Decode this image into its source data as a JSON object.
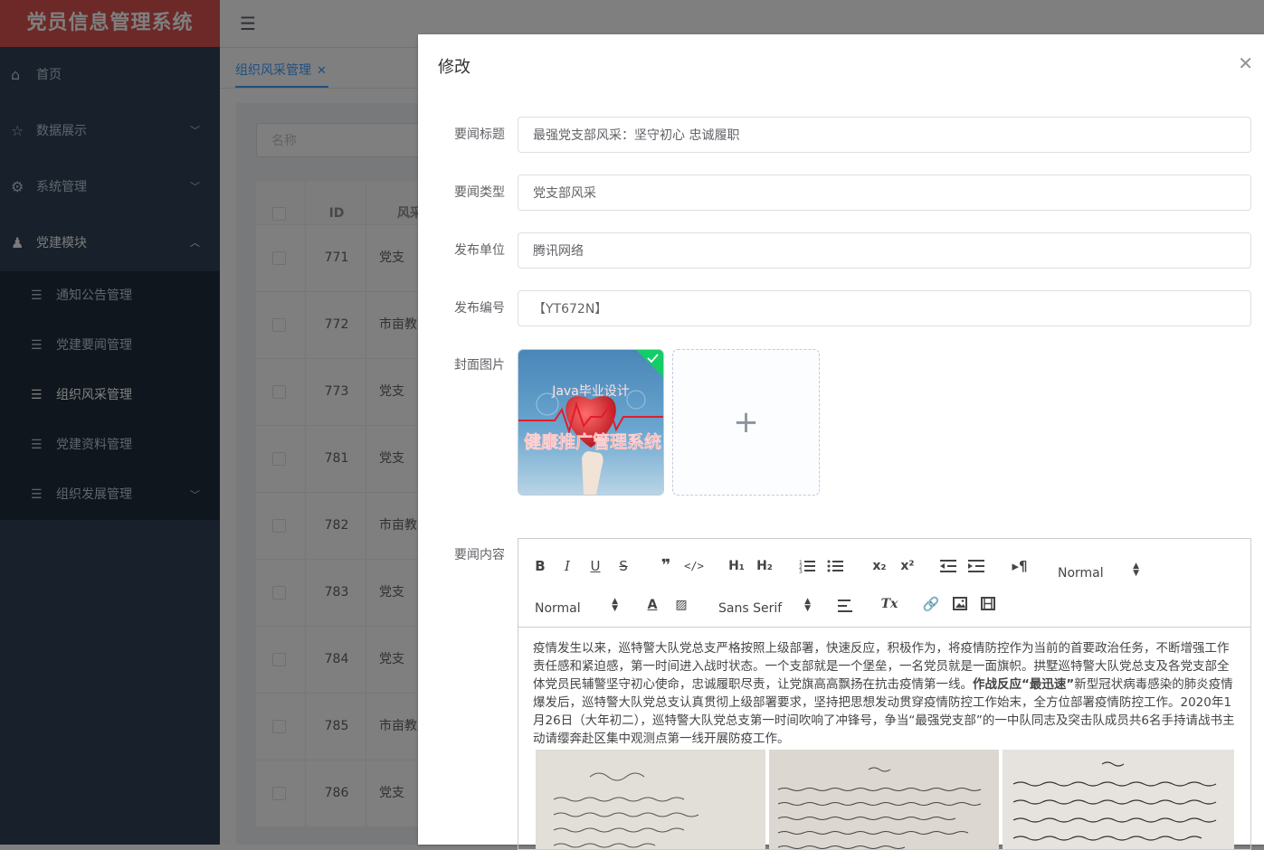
{
  "app": {
    "title": "党员信息管理系统"
  },
  "sidebar": {
    "items": [
      {
        "label": "首页",
        "icon": "home-icon"
      },
      {
        "label": "数据展示",
        "icon": "star-icon"
      },
      {
        "label": "系统管理",
        "icon": "gear-icon"
      },
      {
        "label": "党建模块",
        "icon": "user-group-icon"
      }
    ],
    "subitems": [
      {
        "label": "通知公告管理"
      },
      {
        "label": "党建要闻管理"
      },
      {
        "label": "组织风采管理"
      },
      {
        "label": "党建资料管理"
      },
      {
        "label": "组织发展管理"
      }
    ]
  },
  "tabs": {
    "active": "组织风采管理"
  },
  "list": {
    "search_placeholder": "名称",
    "headers": {
      "id": "ID",
      "name": "风采"
    },
    "rows": [
      {
        "id": "771",
        "name": "党支"
      },
      {
        "id": "772",
        "name": "市亩教"
      },
      {
        "id": "773",
        "name": "党支"
      },
      {
        "id": "781",
        "name": "党支"
      },
      {
        "id": "782",
        "name": "市亩教"
      },
      {
        "id": "783",
        "name": "党支"
      },
      {
        "id": "784",
        "name": "党支"
      },
      {
        "id": "785",
        "name": "市亩教"
      },
      {
        "id": "786",
        "name": "党支"
      }
    ]
  },
  "dialog": {
    "title": "修改",
    "fields": {
      "title_label": "要闻标题",
      "title_value": "最强党支部风采：坚守初心 忠诚履职",
      "type_label": "要闻类型",
      "type_value": "党支部风采",
      "unit_label": "发布单位",
      "unit_value": "腾讯网络",
      "code_label": "发布编号",
      "code_value": "【YT672N】",
      "cover_label": "封面图片",
      "content_label": "要闻内容"
    },
    "cover_text": {
      "line1": "Java毕业设计",
      "line2": "健康推广管理系统"
    },
    "editor": {
      "header_picker": "Normal",
      "size_picker": "Normal",
      "font_picker": "Sans Serif",
      "content_part1": "疫情发生以来，巡特警大队党总支严格按照上级部署，快速反应，积极作为，将疫情防控作为当前的首要政治任务，不断增强工作责任感和紧迫感，第一时间进入战时状态。一个支部就是一个堡垒，一名党员就是一面旗帜。拱墅巡特警大队党总支及各党支部全体党员民辅警坚守初心使命，忠诚履职尽责，让党旗高高飘扬在抗击疫情第一线。",
      "content_bold": "作战反应“最迅速”",
      "content_part2": "新型冠状病毒感染的肺炎疫情爆发后，巡特警大队党总支认真贯彻上级部署要求，坚持把思想发动贯穿疫情防控工作始末，全方位部署疫情防控工作。2020年1月26日（大年初二），巡特警大队党总支第一时间吹响了冲锋号，争当“最强党支部”的一中队同志及突击队成员共6名手持请战书主动请缨奔赴区集中观测点第一线开展防疫工作。"
    }
  },
  "colors": {
    "sidebar_bg": "#304156",
    "logo_bg": "#d9534f",
    "accent": "#409eff"
  }
}
